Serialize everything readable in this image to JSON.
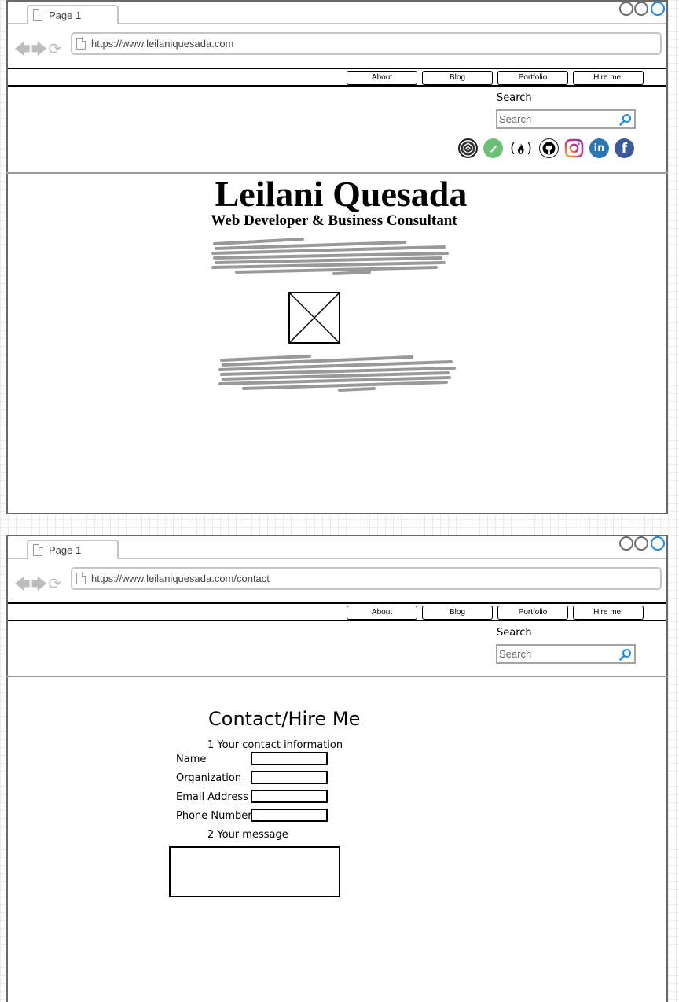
{
  "window1": {
    "tab_title": "Page 1",
    "url": "https://www.leilaniquesada.com",
    "menu": [
      "About",
      "Blog",
      "Portfolio",
      "Hire me!"
    ],
    "search_label": "Search",
    "search_placeholder": "Search",
    "social_icons": [
      "codepen-icon",
      "codewars-icon",
      "freecodecamp-icon",
      "github-icon",
      "instagram-icon",
      "linkedin-icon",
      "facebook-icon"
    ],
    "hero": {
      "name": "Leilani Quesada",
      "subtitle": "Web Developer & Business Consultant"
    }
  },
  "window2": {
    "tab_title": "Page 1",
    "url": "https://www.leilaniquesada.com/contact",
    "menu": [
      "About",
      "Blog",
      "Portfolio",
      "Hire me!"
    ],
    "search_label": "Search",
    "search_placeholder": "Search",
    "contact": {
      "title": "Contact/Hire Me",
      "step1": "1 Your contact information",
      "fields": [
        "Name",
        "Organization",
        "Email Address",
        "Phone Number"
      ],
      "step2": "2 Your message"
    }
  },
  "colors": {
    "accent_blue": "#1f88e5",
    "frame_gray": "#6a6a6a",
    "scribble_gray": "#999999"
  }
}
